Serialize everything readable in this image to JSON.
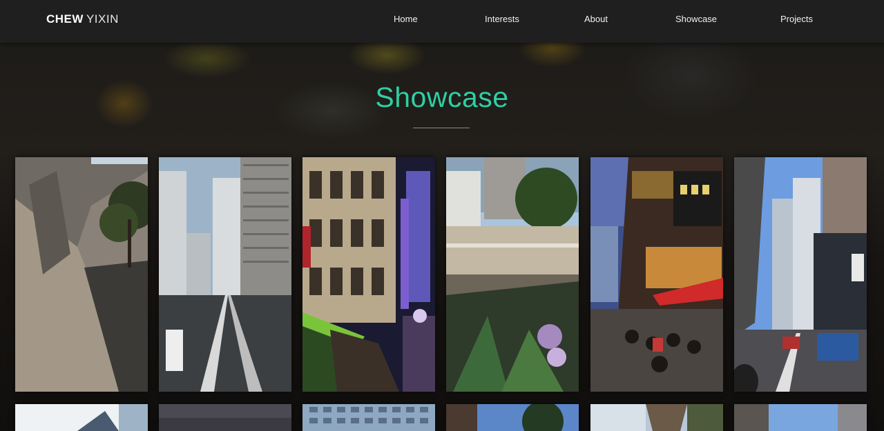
{
  "brand": {
    "first": "CHEW",
    "last": "YIXIN"
  },
  "nav": [
    {
      "label": "Home"
    },
    {
      "label": "Interests"
    },
    {
      "label": "About"
    },
    {
      "label": "Showcase"
    },
    {
      "label": "Projects"
    }
  ],
  "section": {
    "title": "Showcase"
  },
  "colors": {
    "accent": "#2ecfa3",
    "navbar": "#1f1f1f",
    "background": "#151210"
  },
  "gallery": {
    "rows": 2,
    "columns": 6,
    "photos": [
      {
        "subject": "curved concrete building with tree"
      },
      {
        "subject": "high-rise apartments and tram tracks"
      },
      {
        "subject": "city street at night with neon"
      },
      {
        "subject": "heritage building terraces and palm"
      },
      {
        "subject": "neon restaurant street with red umbrellas"
      },
      {
        "subject": "tall buildings and road with bus"
      },
      {
        "subject": "building corner against blue sky"
      },
      {
        "subject": "dark cloudy sky"
      },
      {
        "subject": "colorful apartment block"
      },
      {
        "subject": "tree against sky"
      },
      {
        "subject": "glass facade"
      },
      {
        "subject": "tower and sky"
      }
    ]
  }
}
